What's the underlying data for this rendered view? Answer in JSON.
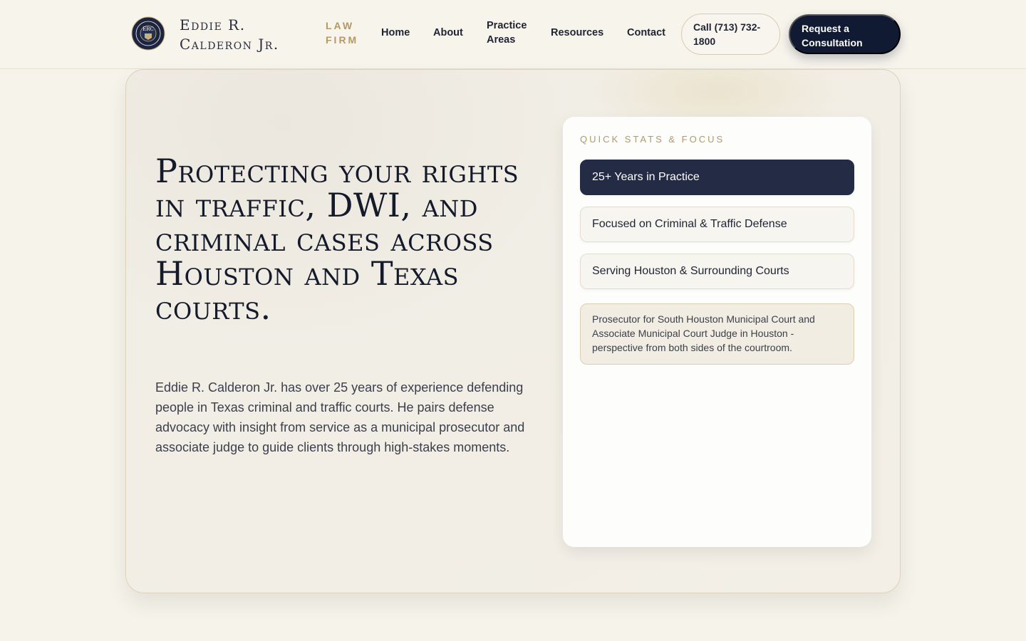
{
  "brand": {
    "name": "Eddie R. Calderon Jr.",
    "tag": "LAW FIRM",
    "logo_text": "ERC"
  },
  "nav": {
    "items": [
      "Home",
      "About",
      "Practice Areas",
      "Resources",
      "Contact"
    ],
    "call_label": "Call (713) 732-1800",
    "cta_label": "Request a Consultation"
  },
  "hero": {
    "title": "Protecting your rights in traffic, DWI, and criminal cases across Houston and Texas courts.",
    "body": "Eddie R. Calderon Jr. has over 25 years of experience defending people in Texas criminal and traffic courts. He pairs defense advocacy with insight from service as a municipal prosecutor and associate judge to guide clients through high-stakes moments."
  },
  "stats": {
    "label": "QUICK STATS & FOCUS",
    "items": [
      "25+ Years in Practice",
      "Focused on Criminal & Traffic Defense",
      "Serving Houston & Surrounding Courts"
    ],
    "note": "Prosecutor for South Houston Municipal Court and Associate Municipal Court Judge in Houston - perspective from both sides of the courtroom."
  },
  "colors": {
    "accent_gold": "#b39868",
    "navy": "#101a33",
    "background": "#f6f3ea"
  }
}
